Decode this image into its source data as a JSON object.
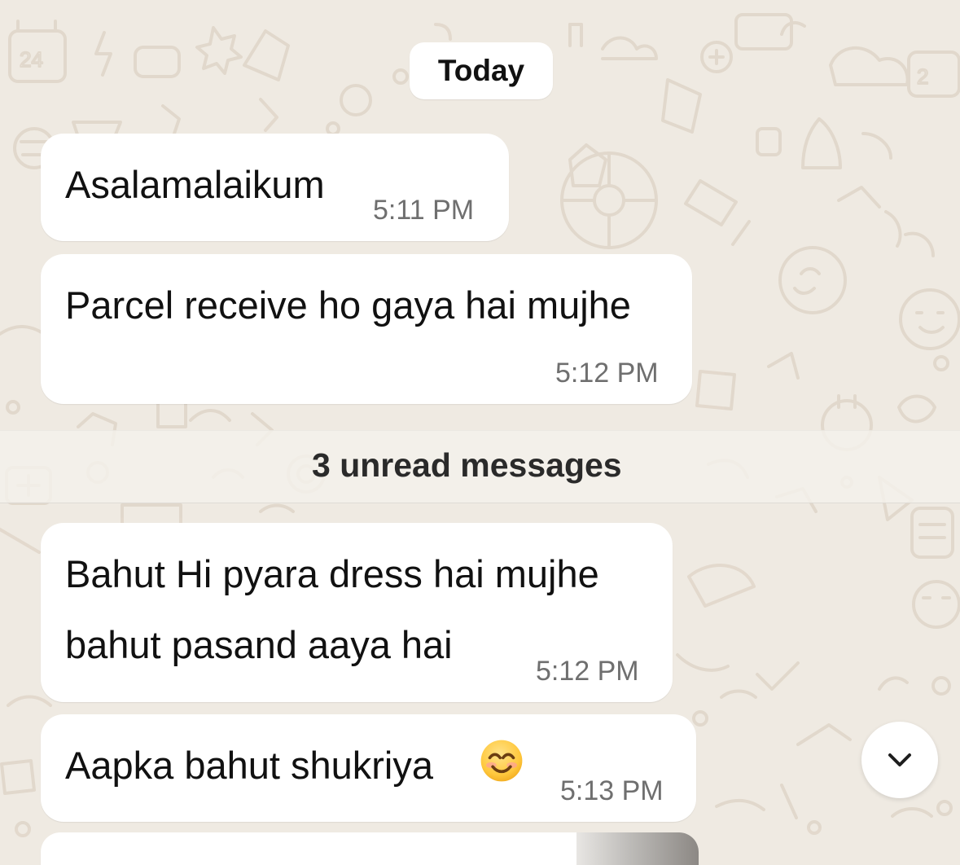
{
  "chat": {
    "date_label": "Today",
    "unread_label": "3 unread messages",
    "messages": [
      {
        "text": "Asalamalaikum",
        "time": "5:11 PM"
      },
      {
        "text": "Parcel receive ho gaya hai mujhe",
        "time": "5:12 PM"
      },
      {
        "line1": "Bahut Hi pyara dress hai mujhe",
        "line2": "bahut pasand aaya hai",
        "time": "5:12 PM"
      },
      {
        "text": "Aapka bahut shukriya",
        "time": "5:13 PM",
        "emoji": "smiling-face-with-smiling-eyes"
      }
    ]
  },
  "colors": {
    "wallpaper": "#efeae2",
    "bubble": "#ffffff",
    "text": "#111111",
    "time": "#6f6f6f"
  }
}
